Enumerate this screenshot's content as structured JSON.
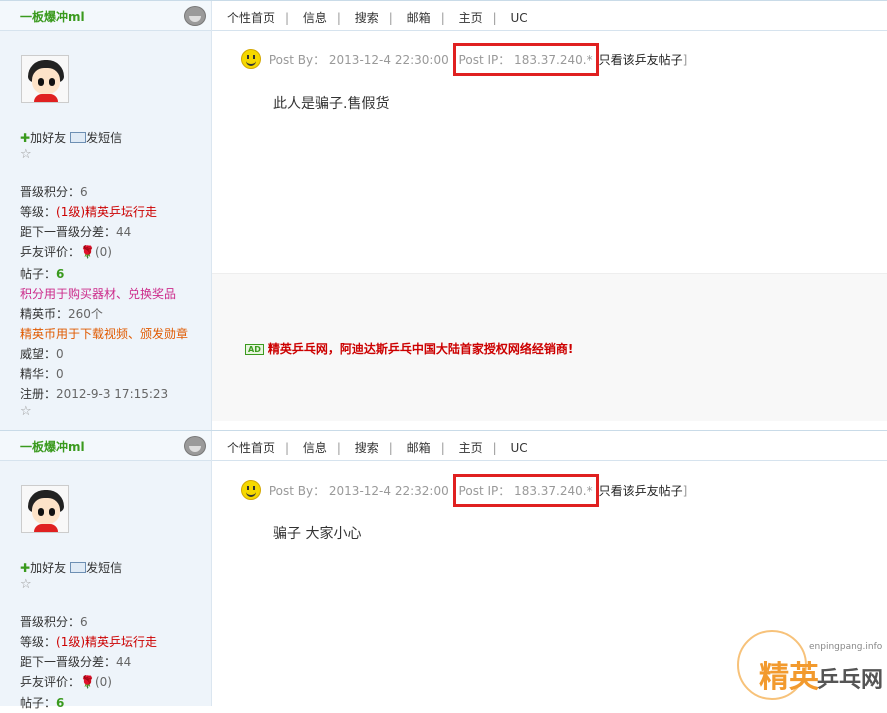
{
  "nav_items": [
    "个性首页",
    "信息",
    "搜索",
    "邮箱",
    "主页",
    "UC"
  ],
  "nav_sep": "|",
  "posts": [
    {
      "username": "一板爆冲ml",
      "add_friend": "加好友",
      "send_msg": "发短信",
      "stats": {
        "jinji_label": "晋级积分：",
        "jinji_value": "6",
        "level_label": "等级：",
        "level_value": "(1级)精英乒坛行走",
        "diff_label": "距下一晋级分差：",
        "diff_value": "44",
        "rating_label": "乒友评价：",
        "rating_value": "(0)",
        "posts_label": "帖子：",
        "posts_value": "6",
        "points_use": "积分用于购买器材、兑换奖品",
        "coin_label": "精英币：",
        "coin_value": "260个",
        "coin_use": "精英币用于下载视频、颁发勋章",
        "prestige_label": "威望：",
        "prestige_value": "0",
        "essence_label": "精华：",
        "essence_value": "0",
        "reg_label": "注册：",
        "reg_value": "2012-9-3 17:15:23"
      },
      "post_by": "Post By：  2013-12-4 22:30:00",
      "post_ip": "Post IP：  183.37.240.*",
      "only_link": "只看该乒友帖子",
      "content": "此人是骗子.售假货"
    },
    {
      "username": "一板爆冲ml",
      "add_friend": "加好友",
      "send_msg": "发短信",
      "stats": {
        "jinji_label": "晋级积分：",
        "jinji_value": "6",
        "level_label": "等级：",
        "level_value": "(1级)精英乒坛行走",
        "diff_label": "距下一晋级分差：",
        "diff_value": "44",
        "rating_label": "乒友评价：",
        "rating_value": "(0)",
        "posts_label": "帖子：",
        "posts_value": "6"
      },
      "post_by": "Post By：  2013-12-4 22:32:00",
      "post_ip": "Post IP：  183.37.240.*",
      "only_link": "只看该乒友帖子",
      "content": "骗子 大家小心"
    }
  ],
  "ad": {
    "tag": "AD",
    "text": "精英乒乓网，阿迪达斯乒乓中国大陆首家授权网络经销商!"
  },
  "watermark": {
    "url": "enpingpang.info",
    "big": "精英",
    "small": "乒乓网"
  }
}
